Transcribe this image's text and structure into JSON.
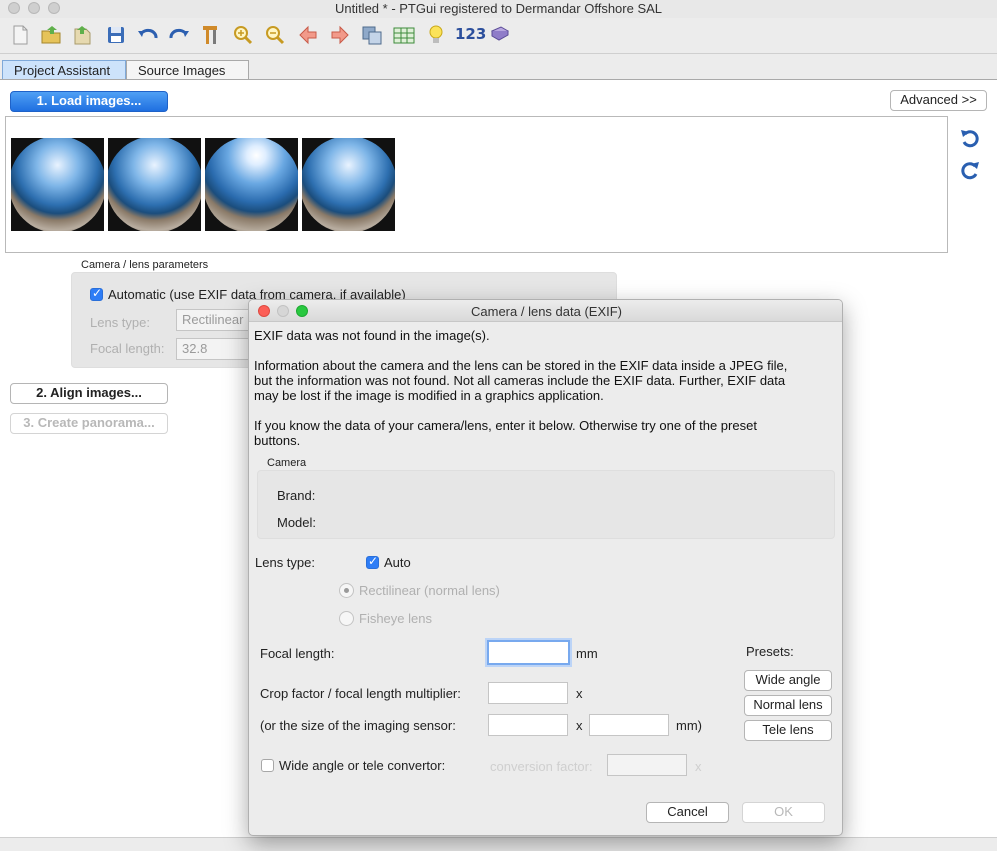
{
  "window": {
    "title": "Untitled * - PTGui registered to Dermandar Offshore SAL"
  },
  "toolbar": {
    "icons": [
      "new-document-icon",
      "open-folder-icon",
      "open-images-icon",
      "save-icon",
      "undo-icon",
      "redo-icon",
      "tools-icon",
      "zoom-in-icon",
      "zoom-out-icon",
      "previous-icon",
      "next-icon",
      "panorama-editor-icon",
      "table-icon",
      "lightbulb-icon",
      "numbers-icon",
      "help-book-icon"
    ],
    "numbers_label": "123"
  },
  "tabs": [
    {
      "label": "Project Assistant",
      "active": true
    },
    {
      "label": "Source Images",
      "active": false
    }
  ],
  "main": {
    "load_button": "1. Load images...",
    "advanced_button": "Advanced >>",
    "align_button": "2. Align images...",
    "create_button": "3. Create panorama...",
    "thumbnails": [
      "source image 1",
      "source image 2",
      "source image 3",
      "source image 4"
    ],
    "camera_group": {
      "label": "Camera / lens parameters",
      "automatic_label": "Automatic (use EXIF data from camera, if available)",
      "automatic_checked": true,
      "lens_type_label": "Lens type:",
      "lens_type_value": "Rectilinear",
      "focal_length_label": "Focal length:",
      "focal_length_value": "32.8"
    }
  },
  "dialog": {
    "title": "Camera / lens data (EXIF)",
    "line1": "EXIF data was not found in the image(s).",
    "para2_line1": "Information about the camera and the lens can be stored in the EXIF data inside a JPEG file,",
    "para2_line2": "but the information was not found. Not all cameras include the EXIF data. Further, EXIF data",
    "para2_line3": "may be lost if the image is modified in a graphics application.",
    "para3_line1": "If you know the data of your camera/lens, enter it below. Otherwise try one of the preset",
    "para3_line2": "buttons.",
    "camera_group_label": "Camera",
    "brand_label": "Brand:",
    "model_label": "Model:",
    "lens_type_label": "Lens type:",
    "auto_label": "Auto",
    "auto_checked": true,
    "rectilinear_label": "Rectilinear (normal lens)",
    "fisheye_label": "Fisheye lens",
    "focal_length_label": "Focal length:",
    "focal_length_value": "",
    "mm_label": "mm",
    "crop_factor_label": "Crop factor / focal length multiplier:",
    "crop_factor_value": "",
    "x_label": "x",
    "sensor_label": "(or the size of the imaging sensor:",
    "sensor_width": "",
    "sensor_height": "",
    "mm_close_label": "mm)",
    "presets_label": "Presets:",
    "wide_angle_button": "Wide angle",
    "normal_lens_button": "Normal lens",
    "tele_lens_button": "Tele lens",
    "convertor_label": "Wide angle or tele convertor:",
    "convertor_checked": false,
    "conversion_factor_label": "conversion factor:",
    "conversion_factor_value": "",
    "cancel_button": "Cancel",
    "ok_button": "OK"
  },
  "colors": {
    "accent_blue": "#1f6fe0",
    "close_red": "#fc5f57",
    "minimize_gray": "#cfcfcf",
    "zoom_green": "#29c840"
  }
}
